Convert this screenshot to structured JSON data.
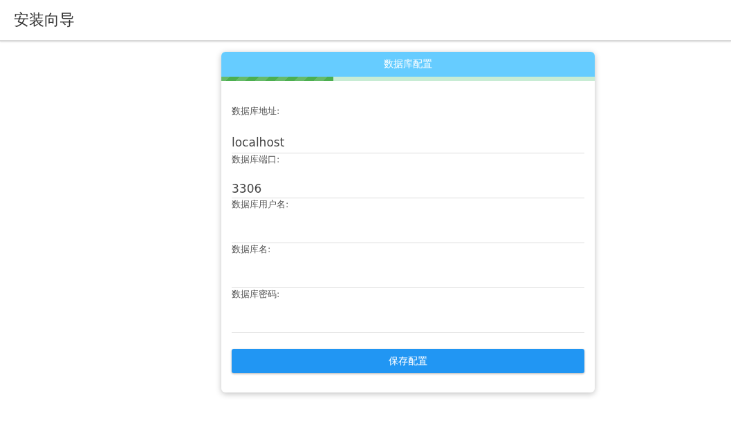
{
  "header": {
    "title": "安装向导"
  },
  "card": {
    "title": "数据库配置",
    "progress": {
      "level": 0.3
    }
  },
  "fields": [
    {
      "label": "数据库地址:",
      "value": "localhost"
    },
    {
      "label": "数据库端口:",
      "value": "3306"
    },
    {
      "label": "数据库用户名:"
    },
    {
      "label": "数据库名:"
    },
    {
      "label": "数据库密码:"
    }
  ],
  "buttons": [
    "保存配置"
  ]
}
